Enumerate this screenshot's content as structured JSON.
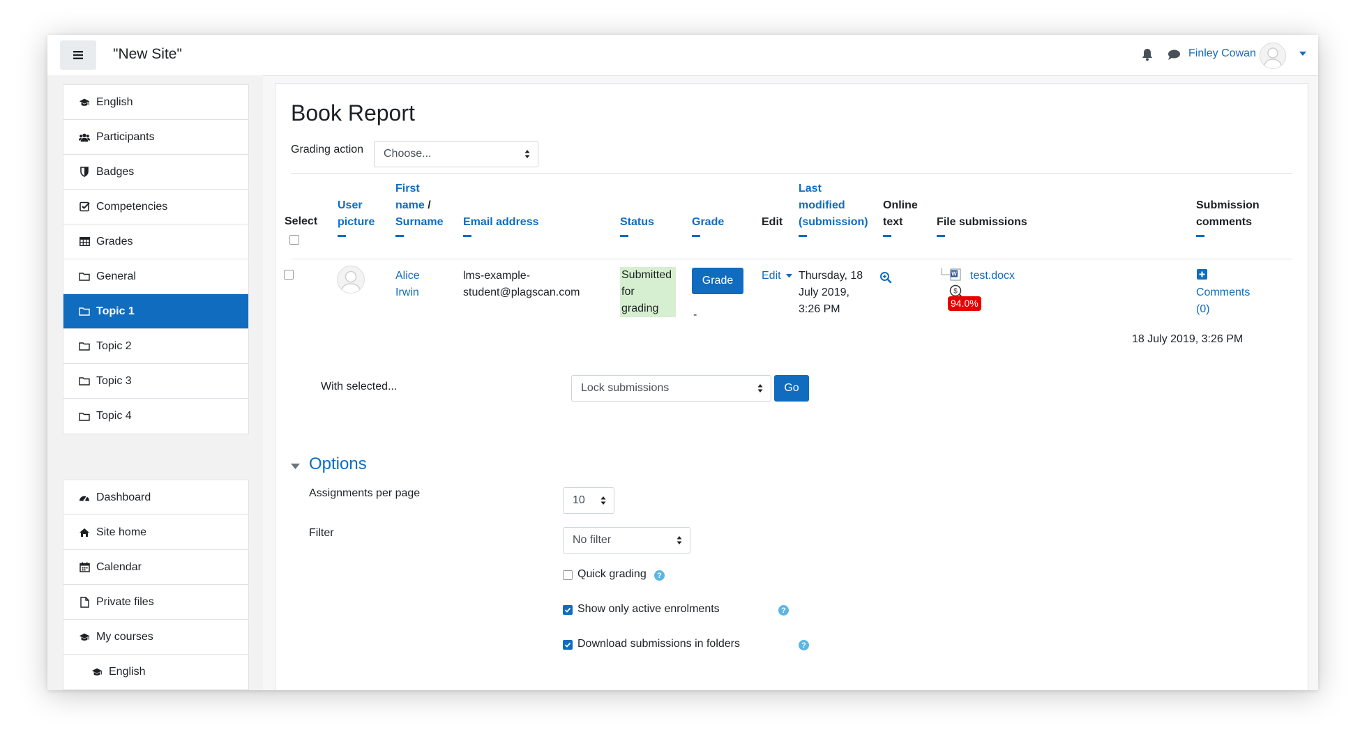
{
  "header": {
    "site_name": "\"New Site\"",
    "user_name": "Finley Cowan"
  },
  "sidebar": {
    "course_items": [
      {
        "label": "English",
        "icon": "graduation-cap-icon"
      },
      {
        "label": "Participants",
        "icon": "users-icon"
      },
      {
        "label": "Badges",
        "icon": "shield-icon"
      },
      {
        "label": "Competencies",
        "icon": "check-square-icon"
      },
      {
        "label": "Grades",
        "icon": "table-icon"
      },
      {
        "label": "General",
        "icon": "folder-icon"
      },
      {
        "label": "Topic 1",
        "icon": "folder-icon",
        "active": true
      },
      {
        "label": "Topic 2",
        "icon": "folder-icon"
      },
      {
        "label": "Topic 3",
        "icon": "folder-icon"
      },
      {
        "label": "Topic 4",
        "icon": "folder-icon"
      }
    ],
    "site_items": [
      {
        "label": "Dashboard",
        "icon": "dashboard-icon"
      },
      {
        "label": "Site home",
        "icon": "home-icon"
      },
      {
        "label": "Calendar",
        "icon": "calendar-icon"
      },
      {
        "label": "Private files",
        "icon": "file-icon"
      },
      {
        "label": "My courses",
        "icon": "graduation-cap-icon"
      },
      {
        "label": "English",
        "icon": "graduation-cap-icon"
      }
    ]
  },
  "main": {
    "title": "Book Report",
    "grading_action_label": "Grading action",
    "grading_action_value": "Choose...",
    "table": {
      "headers": {
        "select": "Select",
        "user_picture": [
          "User",
          "picture"
        ],
        "first_name": [
          "First",
          "name",
          "/",
          "Surname"
        ],
        "email": "Email address",
        "status": "Status",
        "grade": "Grade",
        "edit": "Edit",
        "last_modified": [
          "Last",
          "modified",
          "(submission)"
        ],
        "online_text": [
          "Online",
          "text"
        ],
        "file_submissions": "File submissions",
        "submission_comments": [
          "Submission",
          "comments"
        ]
      },
      "row": {
        "first_name": "Alice",
        "surname": "Irwin",
        "email_line1": "lms-example-",
        "email_line2": "student@plagscan.com",
        "status_lines": [
          "Submitted",
          "for",
          "grading"
        ],
        "grade_button": "Grade",
        "grade_value": "-",
        "edit_label": "Edit",
        "last_modified_lines": [
          "Thursday, 18",
          "July 2019,",
          "3:26 PM"
        ],
        "file_name": "test.docx",
        "plagiarism_score": "94.0%",
        "comments_lines": [
          "Comments",
          "(0)"
        ],
        "file_timestamp": "18 July 2019, 3:26 PM"
      }
    },
    "bulk": {
      "label": "With selected...",
      "value": "Lock submissions",
      "go_button": "Go"
    },
    "options": {
      "title": "Options",
      "per_page_label": "Assignments per page",
      "per_page_value": "10",
      "filter_label": "Filter",
      "filter_value": "No filter",
      "quick_grading": {
        "label": "Quick grading",
        "checked": false
      },
      "active_enrolments": {
        "label": "Show only active enrolments",
        "checked": true
      },
      "download_folders": {
        "label": "Download submissions in folders",
        "checked": true
      }
    }
  },
  "colors": {
    "accent": "#0f6cbf",
    "status_bg": "#d6efd0",
    "badge_red": "#e80000"
  }
}
